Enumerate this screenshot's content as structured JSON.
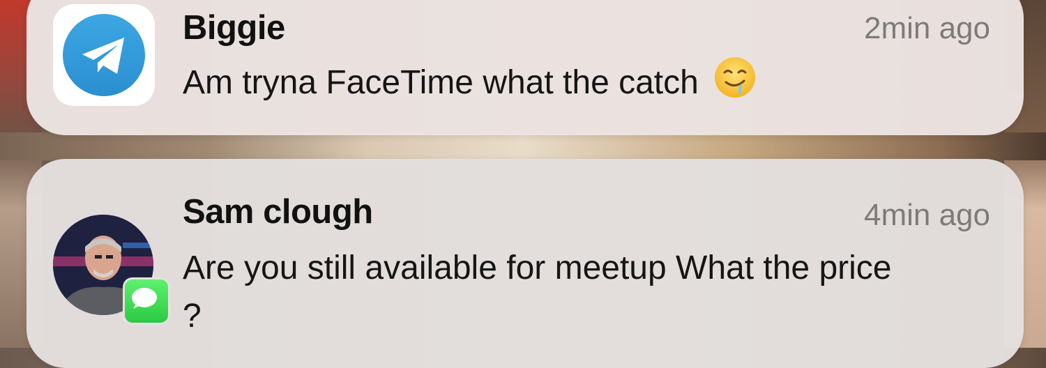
{
  "notifications": [
    {
      "app_icon": "telegram-icon",
      "sender": "Biggie",
      "time": "2min ago",
      "message": "Am tryna FaceTime what the catch",
      "emoji": "drooling-face-emoji"
    },
    {
      "app_icon": "messages-icon",
      "avatar": "contact-avatar-photo",
      "sender": "Sam clough",
      "time": "4min ago",
      "message": "Are you still available for meetup What the price ?"
    }
  ],
  "colors": {
    "telegram_blue": "#2a9ddc",
    "messages_green": "#34c759",
    "card_bg": "#e8e1dd",
    "time_gray": "#7d7a7b"
  }
}
